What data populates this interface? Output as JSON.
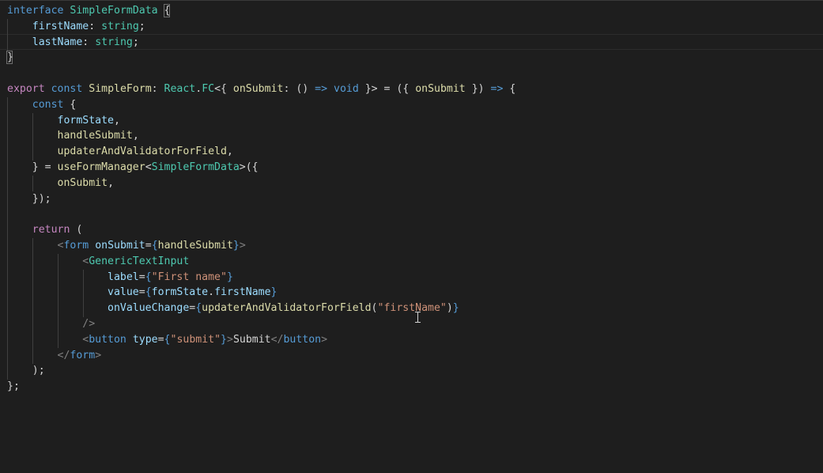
{
  "colors": {
    "background": "#1e1e1e",
    "keyword": "#569cd6",
    "type": "#4ec9b0",
    "variable": "#9cdcfe",
    "function": "#dcdcaa",
    "string": "#ce9178",
    "control": "#c586c0",
    "punctuation": "#d4d4d4",
    "tag": "#808080",
    "jsx_brace": "#569cd6"
  },
  "editor": {
    "cursor_icon": "i-beam-cursor-icon",
    "lines": [
      {
        "tokens": [
          {
            "t": "interface",
            "c": "keyword"
          },
          {
            "t": " ",
            "c": "punctuation"
          },
          {
            "t": "SimpleFormData",
            "c": "type"
          },
          {
            "t": " ",
            "c": "punctuation"
          },
          {
            "t": "{",
            "c": "punctuation"
          }
        ]
      },
      {
        "tokens": [
          {
            "t": "    ",
            "c": "punctuation"
          },
          {
            "t": "firstName",
            "c": "variable"
          },
          {
            "t": ": ",
            "c": "punctuation"
          },
          {
            "t": "string",
            "c": "type"
          },
          {
            "t": ";",
            "c": "punctuation"
          }
        ]
      },
      {
        "tokens": [
          {
            "t": "    ",
            "c": "punctuation"
          },
          {
            "t": "lastName",
            "c": "variable"
          },
          {
            "t": ": ",
            "c": "punctuation"
          },
          {
            "t": "string",
            "c": "type"
          },
          {
            "t": ";",
            "c": "punctuation"
          }
        ]
      },
      {
        "tokens": [
          {
            "t": "}",
            "c": "punctuation"
          }
        ]
      },
      {
        "tokens": []
      },
      {
        "tokens": [
          {
            "t": "export",
            "c": "control"
          },
          {
            "t": " ",
            "c": "punctuation"
          },
          {
            "t": "const",
            "c": "keyword"
          },
          {
            "t": " ",
            "c": "punctuation"
          },
          {
            "t": "SimpleForm",
            "c": "function"
          },
          {
            "t": ": ",
            "c": "punctuation"
          },
          {
            "t": "React",
            "c": "type"
          },
          {
            "t": ".",
            "c": "punctuation"
          },
          {
            "t": "FC",
            "c": "type"
          },
          {
            "t": "<{ ",
            "c": "punctuation"
          },
          {
            "t": "onSubmit",
            "c": "function"
          },
          {
            "t": ": () ",
            "c": "punctuation"
          },
          {
            "t": "=>",
            "c": "keyword"
          },
          {
            "t": " ",
            "c": "punctuation"
          },
          {
            "t": "void",
            "c": "keyword"
          },
          {
            "t": " }> = ({ ",
            "c": "punctuation"
          },
          {
            "t": "onSubmit",
            "c": "function"
          },
          {
            "t": " }) ",
            "c": "punctuation"
          },
          {
            "t": "=>",
            "c": "keyword"
          },
          {
            "t": " {",
            "c": "punctuation"
          }
        ]
      },
      {
        "tokens": [
          {
            "t": "    ",
            "c": "punctuation"
          },
          {
            "t": "const",
            "c": "keyword"
          },
          {
            "t": " {",
            "c": "punctuation"
          }
        ]
      },
      {
        "tokens": [
          {
            "t": "        ",
            "c": "punctuation"
          },
          {
            "t": "formState",
            "c": "variable"
          },
          {
            "t": ",",
            "c": "punctuation"
          }
        ]
      },
      {
        "tokens": [
          {
            "t": "        ",
            "c": "punctuation"
          },
          {
            "t": "handleSubmit",
            "c": "function"
          },
          {
            "t": ",",
            "c": "punctuation"
          }
        ]
      },
      {
        "tokens": [
          {
            "t": "        ",
            "c": "punctuation"
          },
          {
            "t": "updaterAndValidatorForField",
            "c": "function"
          },
          {
            "t": ",",
            "c": "punctuation"
          }
        ]
      },
      {
        "tokens": [
          {
            "t": "    } = ",
            "c": "punctuation"
          },
          {
            "t": "useFormManager",
            "c": "function"
          },
          {
            "t": "<",
            "c": "punctuation"
          },
          {
            "t": "SimpleFormData",
            "c": "type"
          },
          {
            "t": ">({",
            "c": "punctuation"
          }
        ]
      },
      {
        "tokens": [
          {
            "t": "        ",
            "c": "punctuation"
          },
          {
            "t": "onSubmit",
            "c": "function"
          },
          {
            "t": ",",
            "c": "punctuation"
          }
        ]
      },
      {
        "tokens": [
          {
            "t": "    });",
            "c": "punctuation"
          }
        ]
      },
      {
        "tokens": []
      },
      {
        "tokens": [
          {
            "t": "    ",
            "c": "punctuation"
          },
          {
            "t": "return",
            "c": "control"
          },
          {
            "t": " (",
            "c": "punctuation"
          }
        ]
      },
      {
        "tokens": [
          {
            "t": "        ",
            "c": "punctuation"
          },
          {
            "t": "<",
            "c": "tag"
          },
          {
            "t": "form",
            "c": "keyword"
          },
          {
            "t": " ",
            "c": "punctuation"
          },
          {
            "t": "onSubmit",
            "c": "variable"
          },
          {
            "t": "=",
            "c": "punctuation"
          },
          {
            "t": "{",
            "c": "jsx_brace"
          },
          {
            "t": "handleSubmit",
            "c": "function"
          },
          {
            "t": "}",
            "c": "jsx_brace"
          },
          {
            "t": ">",
            "c": "tag"
          }
        ]
      },
      {
        "tokens": [
          {
            "t": "            ",
            "c": "punctuation"
          },
          {
            "t": "<",
            "c": "tag"
          },
          {
            "t": "GenericTextInput",
            "c": "type"
          }
        ]
      },
      {
        "tokens": [
          {
            "t": "                ",
            "c": "punctuation"
          },
          {
            "t": "label",
            "c": "variable"
          },
          {
            "t": "=",
            "c": "punctuation"
          },
          {
            "t": "{",
            "c": "jsx_brace"
          },
          {
            "t": "\"First name\"",
            "c": "string"
          },
          {
            "t": "}",
            "c": "jsx_brace"
          }
        ]
      },
      {
        "tokens": [
          {
            "t": "                ",
            "c": "punctuation"
          },
          {
            "t": "value",
            "c": "variable"
          },
          {
            "t": "=",
            "c": "punctuation"
          },
          {
            "t": "{",
            "c": "jsx_brace"
          },
          {
            "t": "formState",
            "c": "variable"
          },
          {
            "t": ".",
            "c": "punctuation"
          },
          {
            "t": "firstName",
            "c": "variable"
          },
          {
            "t": "}",
            "c": "jsx_brace"
          }
        ]
      },
      {
        "tokens": [
          {
            "t": "                ",
            "c": "punctuation"
          },
          {
            "t": "onValueChange",
            "c": "variable"
          },
          {
            "t": "=",
            "c": "punctuation"
          },
          {
            "t": "{",
            "c": "jsx_brace"
          },
          {
            "t": "updaterAndValidatorForField",
            "c": "function"
          },
          {
            "t": "(",
            "c": "punctuation"
          },
          {
            "t": "\"firstName\"",
            "c": "string"
          },
          {
            "t": ")",
            "c": "punctuation"
          },
          {
            "t": "}",
            "c": "jsx_brace"
          }
        ]
      },
      {
        "tokens": [
          {
            "t": "            ",
            "c": "punctuation"
          },
          {
            "t": "/>",
            "c": "tag"
          }
        ]
      },
      {
        "tokens": [
          {
            "t": "            ",
            "c": "punctuation"
          },
          {
            "t": "<",
            "c": "tag"
          },
          {
            "t": "button",
            "c": "keyword"
          },
          {
            "t": " ",
            "c": "punctuation"
          },
          {
            "t": "type",
            "c": "variable"
          },
          {
            "t": "=",
            "c": "punctuation"
          },
          {
            "t": "{",
            "c": "jsx_brace"
          },
          {
            "t": "\"submit\"",
            "c": "string"
          },
          {
            "t": "}",
            "c": "jsx_brace"
          },
          {
            "t": ">",
            "c": "tag"
          },
          {
            "t": "Submit",
            "c": "punctuation"
          },
          {
            "t": "</",
            "c": "tag"
          },
          {
            "t": "button",
            "c": "keyword"
          },
          {
            "t": ">",
            "c": "tag"
          }
        ]
      },
      {
        "tokens": [
          {
            "t": "        ",
            "c": "punctuation"
          },
          {
            "t": "</",
            "c": "tag"
          },
          {
            "t": "form",
            "c": "keyword"
          },
          {
            "t": ">",
            "c": "tag"
          }
        ]
      },
      {
        "tokens": [
          {
            "t": "    );",
            "c": "punctuation"
          }
        ]
      },
      {
        "tokens": [
          {
            "t": "};",
            "c": "punctuation"
          }
        ]
      }
    ]
  }
}
